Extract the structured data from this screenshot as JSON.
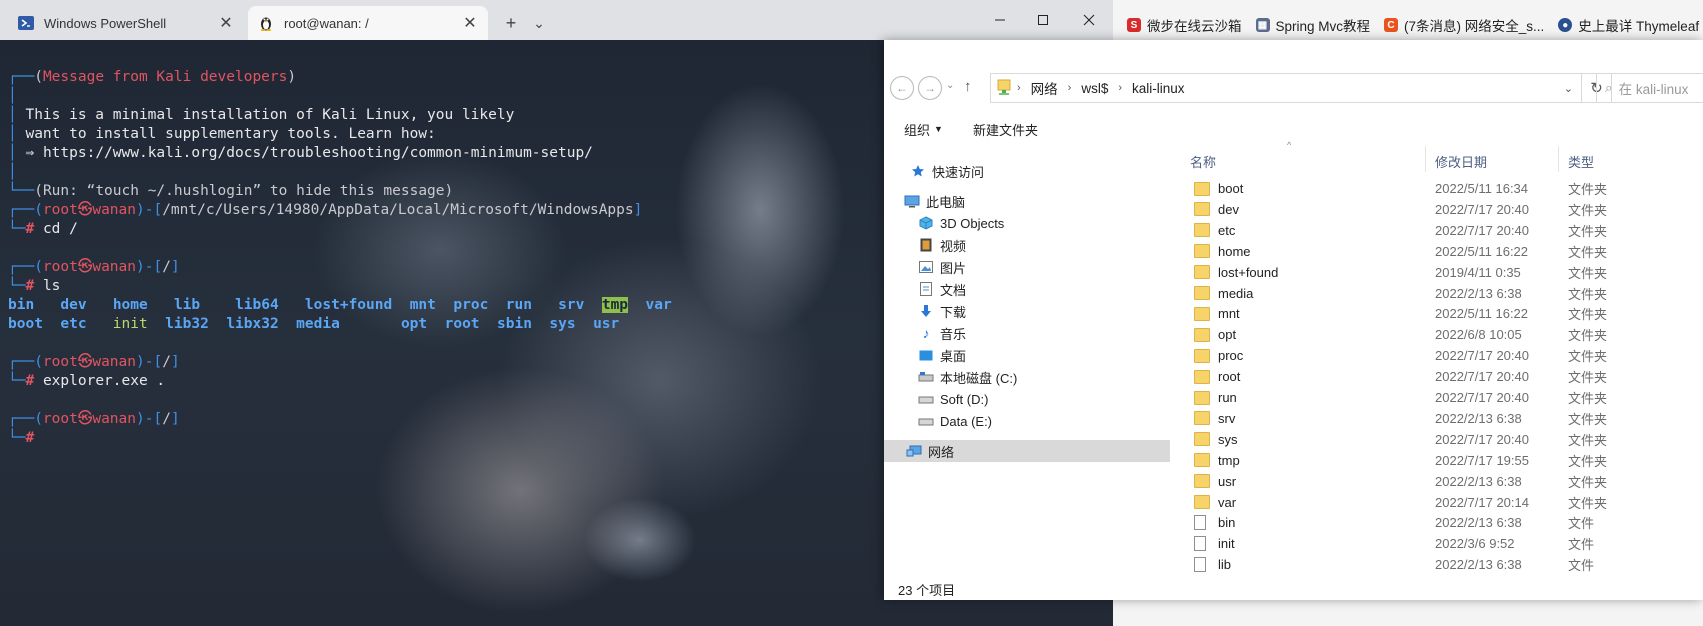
{
  "terminal": {
    "tabs": [
      {
        "label": "Windows PowerShell",
        "icon": "powershell-icon",
        "close": "✕"
      },
      {
        "label": "root@wanan: /",
        "icon": "linux-tux-icon",
        "close": "✕"
      }
    ],
    "new_tab": "+",
    "dropdown": "⌄",
    "lines": {
      "msg_header": "Message from Kali developers",
      "msg1": "This is a minimal installation of Kali Linux, you likely",
      "msg2": "want to install supplementary tools. Learn how:",
      "msg3": "https://www.kali.org/docs/troubleshooting/common-minimum-setup/",
      "msg_footer": "Run: “touch ~/.hushlogin” to hide this message",
      "prompt1_user": "root㉿wanan",
      "prompt1_path": "/mnt/c/Users/14980/AppData/Local/Microsoft/WindowsApps",
      "cmd1": "cd /",
      "prompt2_user": "root㉿wanan",
      "prompt2_path": "/",
      "cmd2": "ls",
      "ls_row1": [
        "bin",
        "dev",
        "home",
        "lib",
        "lib64",
        "lost+found",
        "mnt",
        "proc",
        "run",
        "srv",
        "tmp",
        "var"
      ],
      "ls_row2": [
        "boot",
        "etc",
        "init",
        "lib32",
        "libx32",
        "media",
        "opt",
        "root",
        "sbin",
        "sys",
        "usr"
      ],
      "prompt3_user": "root㉿wanan",
      "prompt3_path": "/",
      "cmd3": "explorer.exe .",
      "prompt4_user": "root㉿wanan",
      "prompt4_path": "/",
      "hash": "#"
    }
  },
  "browser": {
    "bookmarks": [
      {
        "label": "微步在线云沙箱",
        "color": "#d92b2b",
        "glyph": "S"
      },
      {
        "label": "Spring Mvc教程",
        "color": "#5b6d8c",
        "glyph": "▦"
      },
      {
        "label": "(7条消息) 网络安全_s...",
        "color": "#e8541e",
        "glyph": "C"
      },
      {
        "label": "史上最详 Thymeleaf ...",
        "color": "#2b4f8f",
        "glyph": "●"
      }
    ]
  },
  "explorer": {
    "breadcrumb": [
      "网络",
      "wsl$",
      "kali-linux"
    ],
    "search_placeholder": "在 kali-linux",
    "toolbar": {
      "organize": "组织",
      "new_folder": "新建文件夹"
    },
    "nav": [
      {
        "label": "快速访问",
        "icon": "star-quick-access-icon"
      },
      {
        "label": "此电脑",
        "icon": "this-pc-icon"
      },
      {
        "label": "3D Objects",
        "icon": "cube-3d-icon"
      },
      {
        "label": "视频",
        "icon": "video-icon"
      },
      {
        "label": "图片",
        "icon": "picture-icon"
      },
      {
        "label": "文档",
        "icon": "document-icon"
      },
      {
        "label": "下载",
        "icon": "download-arrow-icon"
      },
      {
        "label": "音乐",
        "icon": "music-note-icon"
      },
      {
        "label": "桌面",
        "icon": "desktop-icon"
      },
      {
        "label": "本地磁盘 (C:)",
        "icon": "local-disk-icon"
      },
      {
        "label": "Soft (D:)",
        "icon": "drive-icon"
      },
      {
        "label": "Data (E:)",
        "icon": "drive-icon"
      },
      {
        "label": "网络",
        "icon": "network-icon"
      }
    ],
    "columns": {
      "name": "名称",
      "date": "修改日期",
      "type": "类型"
    },
    "files": [
      {
        "name": "boot",
        "date": "2022/5/11 16:34",
        "type": "文件夹",
        "kind": "folder"
      },
      {
        "name": "dev",
        "date": "2022/7/17 20:40",
        "type": "文件夹",
        "kind": "folder"
      },
      {
        "name": "etc",
        "date": "2022/7/17 20:40",
        "type": "文件夹",
        "kind": "folder"
      },
      {
        "name": "home",
        "date": "2022/5/11 16:22",
        "type": "文件夹",
        "kind": "folder"
      },
      {
        "name": "lost+found",
        "date": "2019/4/11 0:35",
        "type": "文件夹",
        "kind": "folder"
      },
      {
        "name": "media",
        "date": "2022/2/13 6:38",
        "type": "文件夹",
        "kind": "folder"
      },
      {
        "name": "mnt",
        "date": "2022/5/11 16:22",
        "type": "文件夹",
        "kind": "folder"
      },
      {
        "name": "opt",
        "date": "2022/6/8 10:05",
        "type": "文件夹",
        "kind": "folder"
      },
      {
        "name": "proc",
        "date": "2022/7/17 20:40",
        "type": "文件夹",
        "kind": "folder"
      },
      {
        "name": "root",
        "date": "2022/7/17 20:40",
        "type": "文件夹",
        "kind": "folder"
      },
      {
        "name": "run",
        "date": "2022/7/17 20:40",
        "type": "文件夹",
        "kind": "folder"
      },
      {
        "name": "srv",
        "date": "2022/2/13 6:38",
        "type": "文件夹",
        "kind": "folder"
      },
      {
        "name": "sys",
        "date": "2022/7/17 20:40",
        "type": "文件夹",
        "kind": "folder"
      },
      {
        "name": "tmp",
        "date": "2022/7/17 19:55",
        "type": "文件夹",
        "kind": "folder"
      },
      {
        "name": "usr",
        "date": "2022/2/13 6:38",
        "type": "文件夹",
        "kind": "folder"
      },
      {
        "name": "var",
        "date": "2022/7/17 20:14",
        "type": "文件夹",
        "kind": "folder"
      },
      {
        "name": "bin",
        "date": "2022/2/13 6:38",
        "type": "文件",
        "kind": "file"
      },
      {
        "name": "init",
        "date": "2022/3/6 9:52",
        "type": "文件",
        "kind": "file"
      },
      {
        "name": "lib",
        "date": "2022/2/13 6:38",
        "type": "文件",
        "kind": "file"
      }
    ],
    "status": "23 个项目"
  }
}
